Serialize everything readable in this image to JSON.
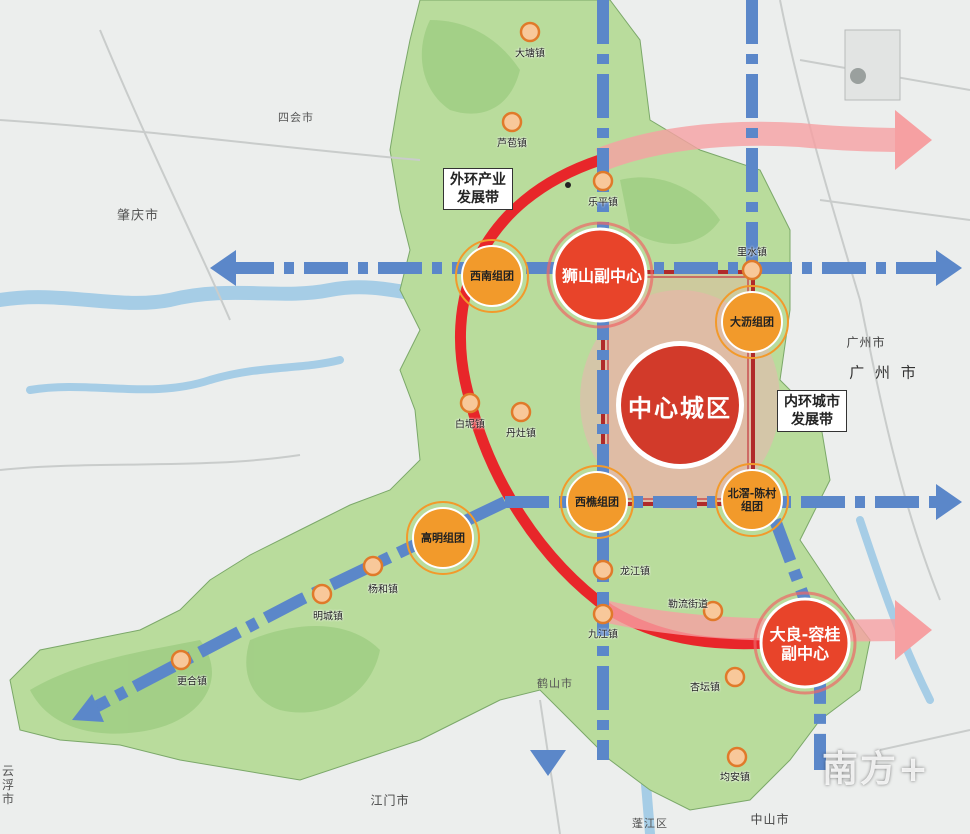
{
  "colors": {
    "terrain": "#b9dc9c",
    "river": "#a6cde6",
    "ring": "#e8262a",
    "axis": "#5b87c9",
    "cluster": "#f29a2b",
    "subcenter": "#e8442a",
    "core": "#d23a2a"
  },
  "callouts": {
    "outer_belt": "外环产业\n发展带",
    "inner_belt": "内环城市\n发展带"
  },
  "core": {
    "label": "中心城区"
  },
  "subcenters": {
    "shishan": "狮山副中心",
    "daliang": "大良-容桂\n副中心"
  },
  "clusters": {
    "xinan": "西南组团",
    "dali": "大沥组团",
    "xiqiao": "西樵组团",
    "beijiao": "北滘-陈村\n组团",
    "gaoming": "高明组团"
  },
  "towns": {
    "datang": "大塘镇",
    "lubao": "芦苞镇",
    "leping": "乐平镇",
    "lishui": "里水镇",
    "baini": "白坭镇",
    "danzao": "丹灶镇",
    "longjiang": "龙江镇",
    "jiujiang": "九江镇",
    "leliu": "勒流街道",
    "xingtan": "杏坛镇",
    "jun_an": "均安镇",
    "yanghe": "杨和镇",
    "mingcheng": "明城镇",
    "genghe": "更合镇"
  },
  "cities": {
    "zhaoqing": "肇庆市",
    "sihui": "四会市",
    "guangzhou_small": "广州市",
    "guangzhou_big": "广 州 市",
    "heshan": "鹤山市",
    "jiangmen": "江门市",
    "zhongshan": "中山市",
    "pengjiang": "蓬江区",
    "yunfu": "云浮市"
  },
  "watermark": "南方+"
}
